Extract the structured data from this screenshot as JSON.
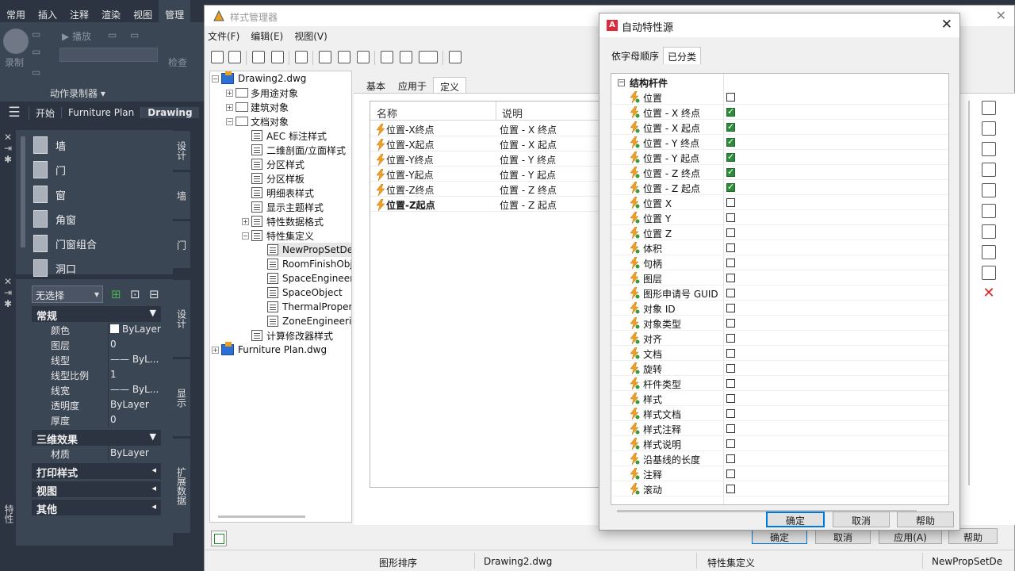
{
  "app": {
    "ribbon_tabs": [
      "常用",
      "插入",
      "注释",
      "渲染",
      "视图",
      "管理"
    ],
    "ribbon": {
      "record": "录制",
      "play": "播放",
      "check": "检查",
      "macro_recorder": "动作录制器"
    },
    "doc_tabs": [
      "开始",
      "Furniture Plan",
      "Drawing"
    ],
    "tool_palette": {
      "items": [
        "墙",
        "门",
        "窗",
        "角窗",
        "门窗组合",
        "洞口"
      ],
      "vertical_tabs": [
        "设计",
        "墙",
        "门"
      ]
    },
    "properties": {
      "selection": "无选择",
      "vertical_tabs": [
        "设计",
        "显示",
        "扩展数据"
      ],
      "side_label": "特性",
      "sections": {
        "general": "常规",
        "three_d": "三维效果",
        "plot": "打印样式",
        "view": "视图",
        "other": "其他"
      },
      "rows": [
        {
          "k": "颜色",
          "v": "ByLayer"
        },
        {
          "k": "图层",
          "v": "0"
        },
        {
          "k": "线型",
          "v": "—— ByL..."
        },
        {
          "k": "线型比例",
          "v": "1"
        },
        {
          "k": "线宽",
          "v": "—— ByL..."
        },
        {
          "k": "透明度",
          "v": "ByLayer"
        },
        {
          "k": "厚度",
          "v": "0"
        }
      ],
      "material": {
        "k": "材质",
        "v": "ByLayer"
      }
    }
  },
  "style_manager": {
    "title": "样式管理器",
    "menu": [
      "文件(F)",
      "编辑(E)",
      "视图(V)"
    ],
    "tree": {
      "drawing": "Drawing2.dwg",
      "multi": "多用途对象",
      "arch": "建筑对象",
      "docobj": "文档对象",
      "items": [
        "AEC 标注样式",
        "二维剖面/立面样式",
        "分区样式",
        "分区样板",
        "明细表样式",
        "显示主题样式",
        "特性数据格式",
        "特性集定义"
      ],
      "propsets": [
        "NewPropSetDef",
        "RoomFinishObjects",
        "SpaceEngineering",
        "SpaceObject",
        "ThermalProperties",
        "ZoneEngineering"
      ],
      "calc": "计算修改器样式",
      "furniture": "Furniture Plan.dwg"
    },
    "tabs": [
      "基本",
      "应用于",
      "定义"
    ],
    "columns": {
      "name": "名称",
      "desc": "说明"
    },
    "rows": [
      {
        "name": "位置-X终点",
        "desc": "位置 - X 终点"
      },
      {
        "name": "位置-X起点",
        "desc": "位置 - X 起点"
      },
      {
        "name": "位置-Y终点",
        "desc": "位置 - Y 终点"
      },
      {
        "name": "位置-Y起点",
        "desc": "位置 - Y 起点"
      },
      {
        "name": "位置-Z终点",
        "desc": "位置 - Z 终点"
      },
      {
        "name": "位置-Z起点",
        "desc": "位置 - Z 起点"
      }
    ],
    "buttons": {
      "ok": "确定",
      "cancel": "取消",
      "apply": "应用(A)",
      "help": "帮助"
    },
    "status": {
      "sort": "图形排序",
      "drawing": "Drawing2.dwg",
      "type": "特性集定义",
      "name": "NewPropSetDe"
    }
  },
  "dialog": {
    "title": "自动特性源",
    "tabs": [
      "依字母顺序",
      "已分类"
    ],
    "group": "结构杆件",
    "properties": [
      {
        "label": "位置",
        "checked": false
      },
      {
        "label": "位置 - X 终点",
        "checked": true
      },
      {
        "label": "位置 - X 起点",
        "checked": true
      },
      {
        "label": "位置 - Y 终点",
        "checked": true
      },
      {
        "label": "位置 - Y 起点",
        "checked": true
      },
      {
        "label": "位置 - Z 终点",
        "checked": true
      },
      {
        "label": "位置 - Z 起点",
        "checked": true
      },
      {
        "label": "位置 X",
        "checked": false
      },
      {
        "label": "位置 Y",
        "checked": false
      },
      {
        "label": "位置 Z",
        "checked": false
      },
      {
        "label": "体积",
        "checked": false
      },
      {
        "label": "句柄",
        "checked": false
      },
      {
        "label": "图层",
        "checked": false
      },
      {
        "label": "图形申请号 GUID",
        "checked": false
      },
      {
        "label": "对象 ID",
        "checked": false
      },
      {
        "label": "对象类型",
        "checked": false
      },
      {
        "label": "对齐",
        "checked": false
      },
      {
        "label": "文档",
        "checked": false
      },
      {
        "label": "旋转",
        "checked": false
      },
      {
        "label": "杆件类型",
        "checked": false
      },
      {
        "label": "样式",
        "checked": false
      },
      {
        "label": "样式文档",
        "checked": false
      },
      {
        "label": "样式注释",
        "checked": false
      },
      {
        "label": "样式说明",
        "checked": false
      },
      {
        "label": "沿基线的长度",
        "checked": false
      },
      {
        "label": "注释",
        "checked": false
      },
      {
        "label": "滚动",
        "checked": false
      }
    ],
    "buttons": {
      "ok": "确定",
      "cancel": "取消",
      "help": "帮助"
    }
  }
}
